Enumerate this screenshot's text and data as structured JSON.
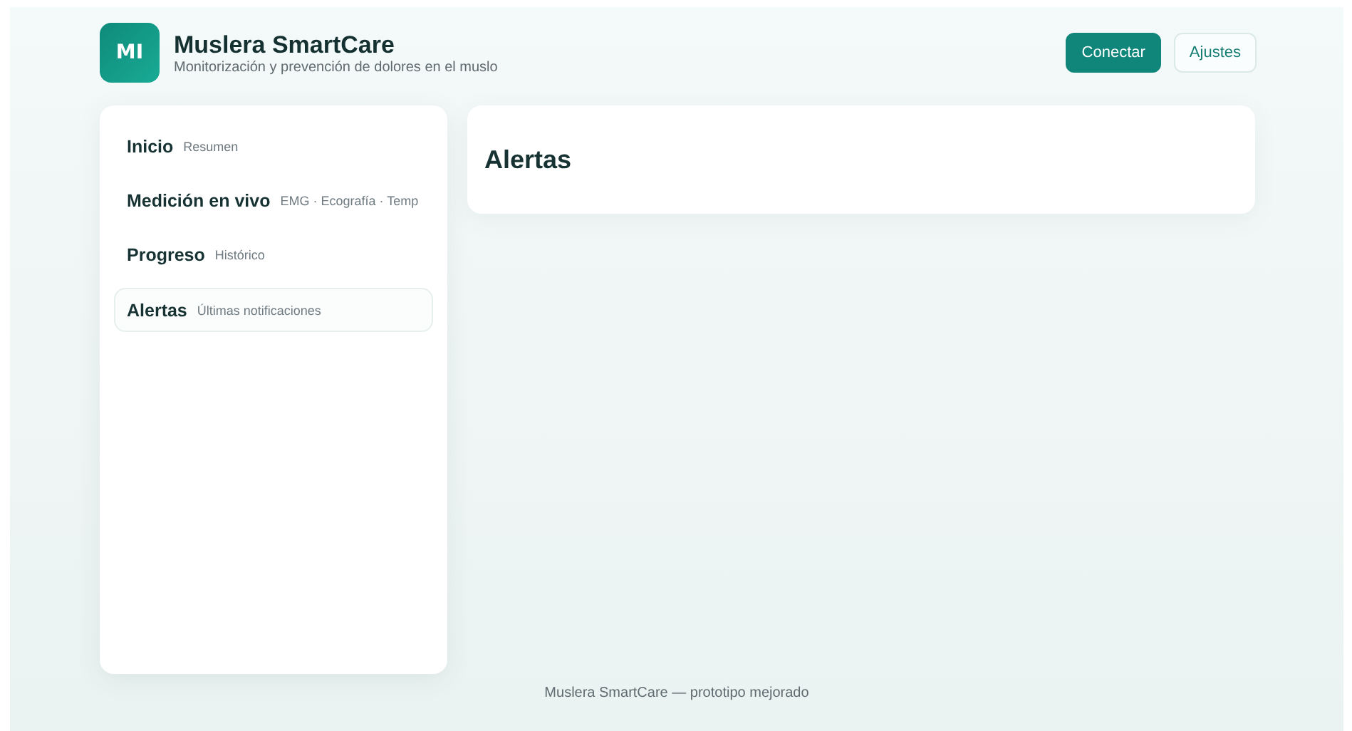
{
  "header": {
    "logo": "MI",
    "title": "Muslera SmartCare",
    "subtitle": "Monitorización y prevención de dolores en el muslo",
    "buttons": [
      {
        "label": "Conectar",
        "kind": "primary"
      },
      {
        "label": "Ajustes",
        "kind": "secondary"
      }
    ]
  },
  "sidebar": {
    "items": [
      {
        "label": "Inicio",
        "hint": "Resumen",
        "selected": false
      },
      {
        "label": "Medición en vivo",
        "hint": "EMG · Ecografía · Temp",
        "selected": false
      },
      {
        "label": "Progreso",
        "hint": "Histórico",
        "selected": false
      },
      {
        "label": "Alertas",
        "hint": "Últimas notificaciones",
        "selected": true
      }
    ]
  },
  "main": {
    "title": "Alertas"
  },
  "footer": "Muslera SmartCare — prototipo mejorado"
}
